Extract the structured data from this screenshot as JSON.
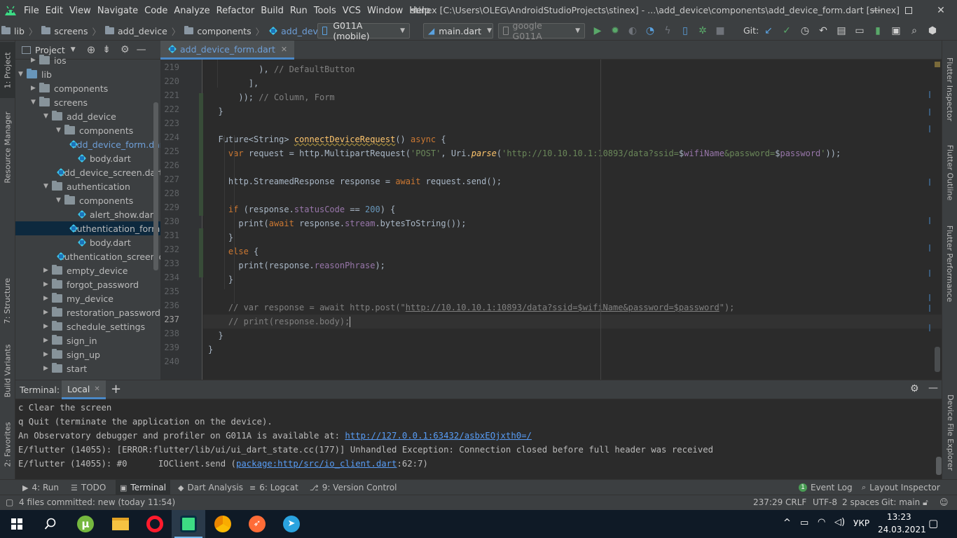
{
  "menubar": {
    "items": [
      "File",
      "Edit",
      "View",
      "Navigate",
      "Code",
      "Analyze",
      "Refactor",
      "Build",
      "Run",
      "Tools",
      "VCS",
      "Window",
      "Help"
    ],
    "window_title": "stinex [C:\\Users\\OLEG\\AndroidStudioProjects\\stinex] - ...\\add_device\\components\\add_device_form.dart [stinex]"
  },
  "navbar": {
    "breadcrumbs": [
      "lib",
      "screens",
      "add_device",
      "components",
      "add_device_form.dart"
    ],
    "device_selector": "G011A (mobile)",
    "run_config": "main.dart",
    "device_combo": "google G011A",
    "git_label": "Git:"
  },
  "left_strip": {
    "project_tab": "1: Project",
    "resource_manager_tab": "Resource Manager",
    "structure_tab": "7: Structure",
    "build_variants_tab": "Build Variants",
    "favorites_tab": "2: Favorites"
  },
  "right_strip": {
    "flutter_inspector": "Flutter Inspector",
    "flutter_outline": "Flutter Outline",
    "flutter_performance": "Flutter Performance",
    "device_file_explorer": "Device File Explorer"
  },
  "project_panel": {
    "title": "Project",
    "tree": [
      {
        "label": "ios",
        "type": "folder",
        "level": 1,
        "state": "collapsed"
      },
      {
        "label": "lib",
        "type": "folder",
        "level": 0,
        "state": "expanded",
        "color": "blue"
      },
      {
        "label": "components",
        "type": "folder",
        "level": 1,
        "state": "collapsed"
      },
      {
        "label": "screens",
        "type": "folder",
        "level": 1,
        "state": "expanded"
      },
      {
        "label": "add_device",
        "type": "folder",
        "level": 2,
        "state": "expanded"
      },
      {
        "label": "components",
        "type": "folder",
        "level": 3,
        "state": "expanded"
      },
      {
        "label": "add_device_form.dart",
        "type": "dart",
        "level": 4,
        "state": "open"
      },
      {
        "label": "body.dart",
        "type": "dart",
        "level": 4
      },
      {
        "label": "add_device_screen.dart",
        "type": "dart",
        "level": 3
      },
      {
        "label": "authentication",
        "type": "folder",
        "level": 2,
        "state": "expanded"
      },
      {
        "label": "components",
        "type": "folder",
        "level": 3,
        "state": "expanded"
      },
      {
        "label": "alert_show.dart",
        "type": "dart",
        "level": 4
      },
      {
        "label": "authentication_form.dart",
        "type": "dart",
        "level": 4,
        "state": "selected"
      },
      {
        "label": "body.dart",
        "type": "dart",
        "level": 4
      },
      {
        "label": "authentication_screen.dart",
        "type": "dart",
        "level": 3
      },
      {
        "label": "empty_device",
        "type": "folder",
        "level": 2,
        "state": "collapsed"
      },
      {
        "label": "forgot_password",
        "type": "folder",
        "level": 2,
        "state": "collapsed"
      },
      {
        "label": "my_device",
        "type": "folder",
        "level": 2,
        "state": "collapsed"
      },
      {
        "label": "restoration_password",
        "type": "folder",
        "level": 2,
        "state": "collapsed"
      },
      {
        "label": "schedule_settings",
        "type": "folder",
        "level": 2,
        "state": "collapsed"
      },
      {
        "label": "sign_in",
        "type": "folder",
        "level": 2,
        "state": "collapsed"
      },
      {
        "label": "sign_up",
        "type": "folder",
        "level": 2,
        "state": "collapsed"
      },
      {
        "label": "start",
        "type": "folder",
        "level": 2,
        "state": "collapsed"
      }
    ]
  },
  "editor": {
    "tab_label": "add_device_form.dart",
    "line_numbers": [
      "219",
      "220",
      "221",
      "222",
      "223",
      "224",
      "225",
      "226",
      "227",
      "228",
      "229",
      "230",
      "231",
      "232",
      "233",
      "234",
      "235",
      "236",
      "237",
      "238",
      "239",
      "240"
    ],
    "current_line": "237",
    "lines": [
      {
        "i": 10,
        "parts": [
          [
            "p",
            "), "
          ],
          [
            "c",
            "// DefaultButton"
          ]
        ]
      },
      {
        "i": 8,
        "parts": [
          [
            "p",
            "],"
          ]
        ]
      },
      {
        "i": 6,
        "parts": [
          [
            "p",
            "));"
          ],
          [
            "c",
            " // Column, Form"
          ]
        ]
      },
      {
        "i": 2,
        "parts": [
          [
            "p",
            "}"
          ]
        ]
      },
      {
        "i": 0,
        "parts": []
      },
      {
        "i": 2,
        "parts": [
          [
            "p",
            "Future<String> "
          ],
          [
            "fn",
            "connectDeviceRequest"
          ],
          [
            "p",
            "() "
          ],
          [
            "k",
            "async"
          ],
          [
            "p",
            " {"
          ]
        ]
      },
      {
        "i": 4,
        "parts": [
          [
            "k",
            "var"
          ],
          [
            "p",
            " request = http.MultipartRequest("
          ],
          [
            "s",
            "'POST'"
          ],
          [
            "p",
            ", Uri."
          ],
          [
            "fi",
            "parse"
          ],
          [
            "p",
            "("
          ],
          [
            "s",
            "'http://10.10.10.1:10893/data?ssid="
          ],
          [
            "p",
            "$"
          ],
          [
            "f",
            "wifiName"
          ],
          [
            "s",
            "&password="
          ],
          [
            "p",
            "$"
          ],
          [
            "f",
            "password"
          ],
          [
            "s",
            "'"
          ],
          [
            "p",
            "));"
          ]
        ]
      },
      {
        "i": 0,
        "parts": []
      },
      {
        "i": 4,
        "parts": [
          [
            "p",
            "http.StreamedResponse response = "
          ],
          [
            "k",
            "await"
          ],
          [
            "p",
            " request.send();"
          ]
        ]
      },
      {
        "i": 0,
        "parts": []
      },
      {
        "i": 4,
        "parts": [
          [
            "k",
            "if"
          ],
          [
            "p",
            " (response."
          ],
          [
            "f",
            "statusCode"
          ],
          [
            "p",
            " == "
          ],
          [
            "n",
            "200"
          ],
          [
            "p",
            ") {"
          ]
        ]
      },
      {
        "i": 6,
        "parts": [
          [
            "p",
            "print("
          ],
          [
            "k",
            "await"
          ],
          [
            "p",
            " response."
          ],
          [
            "f",
            "stream"
          ],
          [
            "p",
            ".bytesToString());"
          ]
        ]
      },
      {
        "i": 4,
        "parts": [
          [
            "p",
            "}"
          ]
        ]
      },
      {
        "i": 4,
        "parts": [
          [
            "k",
            "else"
          ],
          [
            "p",
            " {"
          ]
        ]
      },
      {
        "i": 6,
        "parts": [
          [
            "p",
            "print(response."
          ],
          [
            "f",
            "reasonPhrase"
          ],
          [
            "p",
            ");"
          ]
        ]
      },
      {
        "i": 4,
        "parts": [
          [
            "p",
            "}"
          ]
        ]
      },
      {
        "i": 0,
        "parts": []
      },
      {
        "i": 4,
        "parts": [
          [
            "c",
            "// var response = await http.post(\""
          ],
          [
            "cl",
            "http://10.10.10.1:10893/data?ssid=$wifiName&password=$password"
          ],
          [
            "c",
            "\");"
          ]
        ]
      },
      {
        "i": 4,
        "parts": [
          [
            "c",
            "// print(response.body);"
          ]
        ]
      },
      {
        "i": 2,
        "parts": [
          [
            "p",
            "}"
          ]
        ]
      },
      {
        "i": 0,
        "parts": [
          [
            "p",
            "}"
          ]
        ]
      },
      {
        "i": 0,
        "parts": []
      }
    ]
  },
  "terminal": {
    "title": "Terminal:",
    "tab": "Local",
    "lines": [
      [
        [
          "t",
          "c Clear the screen"
        ]
      ],
      [
        [
          "t",
          "q Quit (terminate the application on the device)."
        ]
      ],
      [
        [
          "t",
          "An Observatory debugger and profiler on G011A is available at: "
        ],
        [
          "l",
          "http://127.0.0.1:63432/asbxEOjxth0=/"
        ]
      ],
      [
        [
          "t",
          "E/flutter (14055): [ERROR:flutter/lib/ui/ui_dart_state.cc(177)] Unhandled Exception: Connection closed before full header was received"
        ]
      ],
      [
        [
          "t",
          "E/flutter (14055): #0      IOClient.send ("
        ],
        [
          "l",
          "package:http/src/io_client.dart"
        ],
        [
          "t",
          ":62:7)"
        ]
      ]
    ]
  },
  "bottom_tabs": {
    "run": "4: Run",
    "todo": "TODO",
    "terminal": "Terminal",
    "dart_analysis": "Dart Analysis",
    "logcat": "6: Logcat",
    "version_control": "9: Version Control",
    "event_log": "Event Log",
    "event_log_count": "1",
    "layout_inspector": "Layout Inspector"
  },
  "statusbar": {
    "message": "4 files committed: new (today 11:54)",
    "position": "237:29",
    "line_sep": "CRLF",
    "encoding": "UTF-8",
    "indent": "2 spaces",
    "git_branch": "Git: main"
  },
  "taskbar": {
    "language": "УКР",
    "time": "13:23",
    "date": "24.03.2021",
    "apps": [
      "utorrent-icon",
      "file-explorer-icon",
      "opera-icon",
      "android-studio-icon",
      "chrome-canary-icon",
      "postman-icon",
      "telegram-icon"
    ]
  },
  "colors": {
    "accent": "#4a88c7",
    "keyword": "#cc7832",
    "string": "#6a8759",
    "comment": "#808080",
    "field": "#9876aa",
    "number": "#6897bb",
    "function": "#ffc66d"
  }
}
